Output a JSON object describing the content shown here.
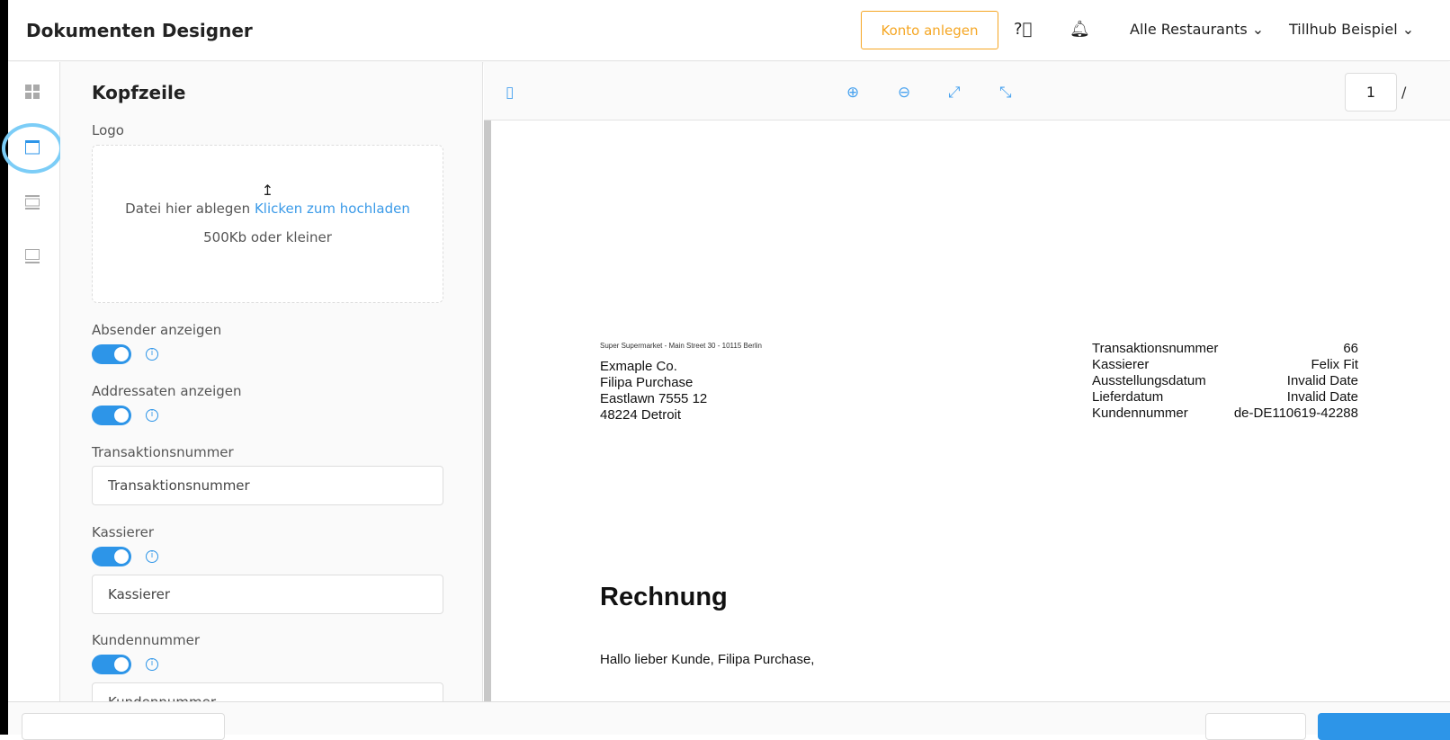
{
  "header": {
    "title": "Dokumenten Designer",
    "konto_button": "Konto anlegen",
    "restaurants": "Alle Restaurants",
    "account": "Tillhub Beispiel"
  },
  "rail": {
    "items": [
      "grid-icon",
      "header-layout-icon",
      "body-layout-icon",
      "footer-layout-icon"
    ],
    "active": 1,
    "highlight_color": "#7ccdf7"
  },
  "panel": {
    "title": "Kopfzeile",
    "logo_label": "Logo",
    "drop_text": "Datei hier ablegen",
    "drop_link": "Klicken zum hochladen",
    "drop_hint": "500Kb oder kleiner",
    "absender_label": "Absender anzeigen",
    "absender_on": true,
    "addressaten_label": "Addressaten anzeigen",
    "addressaten_on": true,
    "transaktion_label": "Transaktionsnummer",
    "transaktion_value": "Transaktionsnummer",
    "kassierer_label": "Kassierer",
    "kassierer_on": true,
    "kassierer_value": "Kassierer",
    "kunden_label": "Kundennummer",
    "kunden_on": true,
    "kunden_value": "Kundennummer"
  },
  "preview": {
    "page": "1",
    "page_sep": "/",
    "sender": "Super Supermarket - Main Street 30 - 10115 Berlin",
    "address": [
      "Exmaple Co.",
      "Filipa Purchase",
      "Eastlawn 7555 12",
      "48224 Detroit"
    ],
    "meta": [
      {
        "k": "Transaktionsnummer",
        "v": "66"
      },
      {
        "k": "Kassierer",
        "v": "Felix Fit"
      },
      {
        "k": "Ausstellungsdatum",
        "v": "Invalid Date"
      },
      {
        "k": "Lieferdatum",
        "v": "Invalid Date"
      },
      {
        "k": "Kundennummer",
        "v": "de-DE110619-42288"
      }
    ],
    "heading": "Rechnung",
    "greeting": "Hallo lieber Kunde, Filipa Purchase,"
  },
  "colors": {
    "accent": "#2d95e8",
    "konto": "#f5a623"
  }
}
